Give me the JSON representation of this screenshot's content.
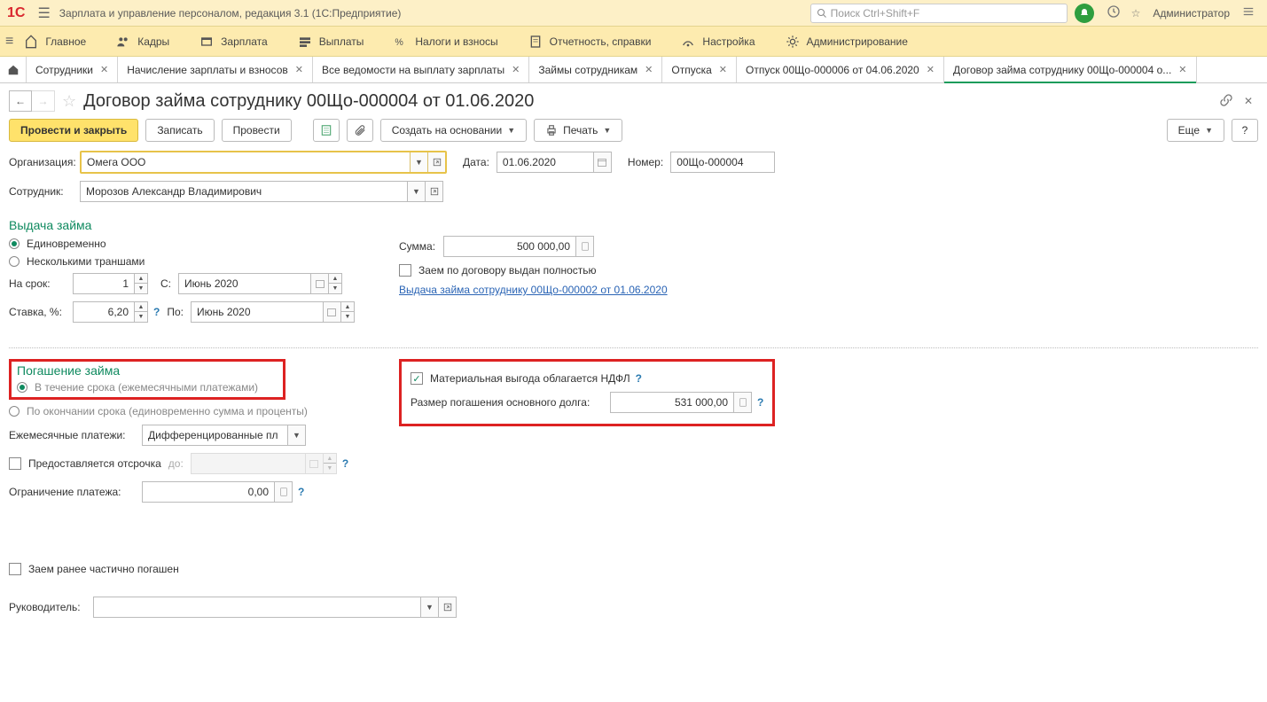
{
  "app": {
    "title": "Зарплата и управление персоналом, редакция 3.1  (1С:Предприятие)",
    "search_placeholder": "Поиск Ctrl+Shift+F",
    "user": "Администратор"
  },
  "nav": {
    "items": [
      {
        "label": "Главное"
      },
      {
        "label": "Кадры"
      },
      {
        "label": "Зарплата"
      },
      {
        "label": "Выплаты"
      },
      {
        "label": "Налоги и взносы"
      },
      {
        "label": "Отчетность, справки"
      },
      {
        "label": "Настройка"
      },
      {
        "label": "Администрирование"
      }
    ]
  },
  "tabs": [
    {
      "label": "Сотрудники"
    },
    {
      "label": "Начисление зарплаты и взносов"
    },
    {
      "label": "Все ведомости на выплату зарплаты"
    },
    {
      "label": "Займы сотрудникам"
    },
    {
      "label": "Отпуска"
    },
    {
      "label": "Отпуск 00Що-000006 от 04.06.2020"
    },
    {
      "label": "Договор займа сотруднику 00Що-000004 о..."
    }
  ],
  "doc_title": "Договор займа сотруднику 00Що-000004 от 01.06.2020",
  "toolbar": {
    "post_close": "Провести и закрыть",
    "save": "Записать",
    "post": "Провести",
    "create_based": "Создать на основании",
    "print": "Печать",
    "more": "Еще",
    "help": "?"
  },
  "fields": {
    "org_label": "Организация:",
    "org_value": "Омега ООО",
    "date_label": "Дата:",
    "date_value": "01.06.2020",
    "number_label": "Номер:",
    "number_value": "00Що-000004",
    "employee_label": "Сотрудник:",
    "employee_value": "Морозов Александр Владимирович"
  },
  "issue": {
    "section": "Выдача займа",
    "r1": "Единовременно",
    "r2": "Несколькими траншами",
    "term_label": "На срок:",
    "term_value": "1",
    "term_from_label": "С:",
    "term_from_value": "Июнь 2020",
    "rate_label": "Ставка, %:",
    "rate_value": "6,20",
    "term_to_label": "По:",
    "term_to_value": "Июнь 2020",
    "sum_label": "Сумма:",
    "sum_value": "500 000,00",
    "fully_issued": "Заем по договору выдан полностью",
    "link": "Выдача займа сотруднику 00Що-000002 от 01.06.2020"
  },
  "repay": {
    "section": "Погашение займа",
    "r1": "В течение срока (ежемесячными платежами)",
    "r2": "По окончании срока (единовременно сумма и проценты)",
    "monthly_label": "Ежемесячные платежи:",
    "monthly_value": "Дифференцированные пл",
    "deferral": "Предоставляется отсрочка",
    "deferral_until": "до:",
    "limit_label": "Ограничение платежа:",
    "limit_value": "0,00",
    "ndfl": "Материальная выгода облагается НДФЛ",
    "principal_label": "Размер погашения основного долга:",
    "principal_value": "531 000,00"
  },
  "footer": {
    "previously_repaid": "Заем ранее частично погашен",
    "manager_label": "Руководитель:"
  }
}
